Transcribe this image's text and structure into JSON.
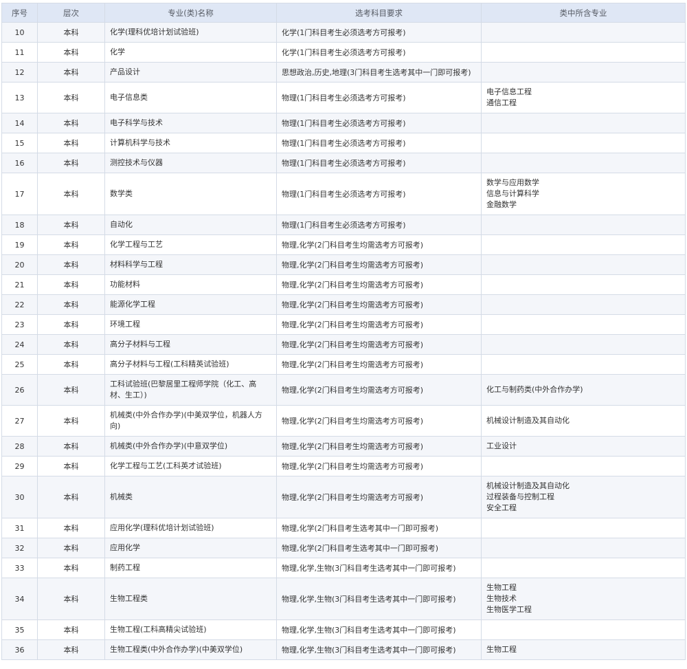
{
  "headers": [
    "序号",
    "层次",
    "专业(类)名称",
    "选考科目要求",
    "类中所含专业"
  ],
  "rows": [
    {
      "num": "10",
      "level": "本科",
      "name": "化学(理科优培计划试验班)",
      "req": "化学(1门科目考生必须选考方可报考)",
      "subs": []
    },
    {
      "num": "11",
      "level": "本科",
      "name": "化学",
      "req": "化学(1门科目考生必须选考方可报考)",
      "subs": []
    },
    {
      "num": "12",
      "level": "本科",
      "name": "产品设计",
      "req": "思想政治,历史,地理(3门科目考生选考其中一门即可报考)",
      "subs": []
    },
    {
      "num": "13",
      "level": "本科",
      "name": "电子信息类",
      "req": "物理(1门科目考生必须选考方可报考)",
      "subs": [
        "电子信息工程",
        "通信工程"
      ]
    },
    {
      "num": "14",
      "level": "本科",
      "name": "电子科学与技术",
      "req": "物理(1门科目考生必须选考方可报考)",
      "subs": []
    },
    {
      "num": "15",
      "level": "本科",
      "name": "计算机科学与技术",
      "req": "物理(1门科目考生必须选考方可报考)",
      "subs": []
    },
    {
      "num": "16",
      "level": "本科",
      "name": "测控技术与仪器",
      "req": "物理(1门科目考生必须选考方可报考)",
      "subs": []
    },
    {
      "num": "17",
      "level": "本科",
      "name": "数学类",
      "req": "物理(1门科目考生必须选考方可报考)",
      "subs": [
        "数学与应用数学",
        "信息与计算科学",
        "金融数学"
      ]
    },
    {
      "num": "18",
      "level": "本科",
      "name": "自动化",
      "req": "物理(1门科目考生必须选考方可报考)",
      "subs": []
    },
    {
      "num": "19",
      "level": "本科",
      "name": "化学工程与工艺",
      "req": "物理,化学(2门科目考生均需选考方可报考)",
      "subs": []
    },
    {
      "num": "20",
      "level": "本科",
      "name": "材料科学与工程",
      "req": "物理,化学(2门科目考生均需选考方可报考)",
      "subs": []
    },
    {
      "num": "21",
      "level": "本科",
      "name": "功能材料",
      "req": "物理,化学(2门科目考生均需选考方可报考)",
      "subs": []
    },
    {
      "num": "22",
      "level": "本科",
      "name": "能源化学工程",
      "req": "物理,化学(2门科目考生均需选考方可报考)",
      "subs": []
    },
    {
      "num": "23",
      "level": "本科",
      "name": "环境工程",
      "req": "物理,化学(2门科目考生均需选考方可报考)",
      "subs": []
    },
    {
      "num": "24",
      "level": "本科",
      "name": "高分子材料与工程",
      "req": "物理,化学(2门科目考生均需选考方可报考)",
      "subs": []
    },
    {
      "num": "25",
      "level": "本科",
      "name": "高分子材料与工程(工科精英试验班)",
      "req": "物理,化学(2门科目考生均需选考方可报考)",
      "subs": []
    },
    {
      "num": "26",
      "level": "本科",
      "name": "工科试验班(巴黎居里工程师学院（化工、高材、生工）)",
      "req": "物理,化学(2门科目考生均需选考方可报考)",
      "subs": [
        "化工与制药类(中外合作办学)"
      ]
    },
    {
      "num": "27",
      "level": "本科",
      "name": "机械类(中外合作办学)(中美双学位，机器人方向)",
      "req": "物理,化学(2门科目考生均需选考方可报考)",
      "subs": [
        "机械设计制造及其自动化"
      ]
    },
    {
      "num": "28",
      "level": "本科",
      "name": "机械类(中外合作办学)(中意双学位)",
      "req": "物理,化学(2门科目考生均需选考方可报考)",
      "subs": [
        "工业设计"
      ]
    },
    {
      "num": "29",
      "level": "本科",
      "name": "化学工程与工艺(工科英才试验班)",
      "req": "物理,化学(2门科目考生均需选考方可报考)",
      "subs": []
    },
    {
      "num": "30",
      "level": "本科",
      "name": "机械类",
      "req": "物理,化学(2门科目考生均需选考方可报考)",
      "subs": [
        "机械设计制造及其自动化",
        "过程装备与控制工程",
        "安全工程"
      ]
    },
    {
      "num": "31",
      "level": "本科",
      "name": "应用化学(理科优培计划试验班)",
      "req": "物理,化学(2门科目考生选考其中一门即可报考)",
      "subs": []
    },
    {
      "num": "32",
      "level": "本科",
      "name": "应用化学",
      "req": "物理,化学(2门科目考生选考其中一门即可报考)",
      "subs": []
    },
    {
      "num": "33",
      "level": "本科",
      "name": "制药工程",
      "req": "物理,化学,生物(3门科目考生选考其中一门即可报考)",
      "subs": []
    },
    {
      "num": "34",
      "level": "本科",
      "name": "生物工程类",
      "req": "物理,化学,生物(3门科目考生选考其中一门即可报考)",
      "subs": [
        "生物工程",
        "生物技术",
        "生物医学工程"
      ]
    },
    {
      "num": "35",
      "level": "本科",
      "name": "生物工程(工科高精尖试验班)",
      "req": "物理,化学,生物(3门科目考生选考其中一门即可报考)",
      "subs": []
    },
    {
      "num": "36",
      "level": "本科",
      "name": "生物工程类(中外合作办学)(中美双学位)",
      "req": "物理,化学,生物(3门科目考生选考其中一门即可报考)",
      "subs": [
        "生物工程"
      ]
    }
  ]
}
